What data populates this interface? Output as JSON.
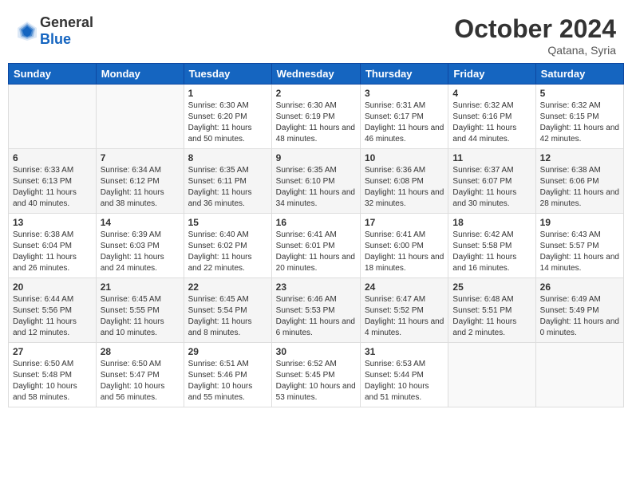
{
  "logo": {
    "general": "General",
    "blue": "Blue"
  },
  "title": "October 2024",
  "location": "Qatana, Syria",
  "days_of_week": [
    "Sunday",
    "Monday",
    "Tuesday",
    "Wednesday",
    "Thursday",
    "Friday",
    "Saturday"
  ],
  "weeks": [
    [
      {
        "day": "",
        "info": ""
      },
      {
        "day": "",
        "info": ""
      },
      {
        "day": "1",
        "info": "Sunrise: 6:30 AM\nSunset: 6:20 PM\nDaylight: 11 hours and 50 minutes."
      },
      {
        "day": "2",
        "info": "Sunrise: 6:30 AM\nSunset: 6:19 PM\nDaylight: 11 hours and 48 minutes."
      },
      {
        "day": "3",
        "info": "Sunrise: 6:31 AM\nSunset: 6:17 PM\nDaylight: 11 hours and 46 minutes."
      },
      {
        "day": "4",
        "info": "Sunrise: 6:32 AM\nSunset: 6:16 PM\nDaylight: 11 hours and 44 minutes."
      },
      {
        "day": "5",
        "info": "Sunrise: 6:32 AM\nSunset: 6:15 PM\nDaylight: 11 hours and 42 minutes."
      }
    ],
    [
      {
        "day": "6",
        "info": "Sunrise: 6:33 AM\nSunset: 6:13 PM\nDaylight: 11 hours and 40 minutes."
      },
      {
        "day": "7",
        "info": "Sunrise: 6:34 AM\nSunset: 6:12 PM\nDaylight: 11 hours and 38 minutes."
      },
      {
        "day": "8",
        "info": "Sunrise: 6:35 AM\nSunset: 6:11 PM\nDaylight: 11 hours and 36 minutes."
      },
      {
        "day": "9",
        "info": "Sunrise: 6:35 AM\nSunset: 6:10 PM\nDaylight: 11 hours and 34 minutes."
      },
      {
        "day": "10",
        "info": "Sunrise: 6:36 AM\nSunset: 6:08 PM\nDaylight: 11 hours and 32 minutes."
      },
      {
        "day": "11",
        "info": "Sunrise: 6:37 AM\nSunset: 6:07 PM\nDaylight: 11 hours and 30 minutes."
      },
      {
        "day": "12",
        "info": "Sunrise: 6:38 AM\nSunset: 6:06 PM\nDaylight: 11 hours and 28 minutes."
      }
    ],
    [
      {
        "day": "13",
        "info": "Sunrise: 6:38 AM\nSunset: 6:04 PM\nDaylight: 11 hours and 26 minutes."
      },
      {
        "day": "14",
        "info": "Sunrise: 6:39 AM\nSunset: 6:03 PM\nDaylight: 11 hours and 24 minutes."
      },
      {
        "day": "15",
        "info": "Sunrise: 6:40 AM\nSunset: 6:02 PM\nDaylight: 11 hours and 22 minutes."
      },
      {
        "day": "16",
        "info": "Sunrise: 6:41 AM\nSunset: 6:01 PM\nDaylight: 11 hours and 20 minutes."
      },
      {
        "day": "17",
        "info": "Sunrise: 6:41 AM\nSunset: 6:00 PM\nDaylight: 11 hours and 18 minutes."
      },
      {
        "day": "18",
        "info": "Sunrise: 6:42 AM\nSunset: 5:58 PM\nDaylight: 11 hours and 16 minutes."
      },
      {
        "day": "19",
        "info": "Sunrise: 6:43 AM\nSunset: 5:57 PM\nDaylight: 11 hours and 14 minutes."
      }
    ],
    [
      {
        "day": "20",
        "info": "Sunrise: 6:44 AM\nSunset: 5:56 PM\nDaylight: 11 hours and 12 minutes."
      },
      {
        "day": "21",
        "info": "Sunrise: 6:45 AM\nSunset: 5:55 PM\nDaylight: 11 hours and 10 minutes."
      },
      {
        "day": "22",
        "info": "Sunrise: 6:45 AM\nSunset: 5:54 PM\nDaylight: 11 hours and 8 minutes."
      },
      {
        "day": "23",
        "info": "Sunrise: 6:46 AM\nSunset: 5:53 PM\nDaylight: 11 hours and 6 minutes."
      },
      {
        "day": "24",
        "info": "Sunrise: 6:47 AM\nSunset: 5:52 PM\nDaylight: 11 hours and 4 minutes."
      },
      {
        "day": "25",
        "info": "Sunrise: 6:48 AM\nSunset: 5:51 PM\nDaylight: 11 hours and 2 minutes."
      },
      {
        "day": "26",
        "info": "Sunrise: 6:49 AM\nSunset: 5:49 PM\nDaylight: 11 hours and 0 minutes."
      }
    ],
    [
      {
        "day": "27",
        "info": "Sunrise: 6:50 AM\nSunset: 5:48 PM\nDaylight: 10 hours and 58 minutes."
      },
      {
        "day": "28",
        "info": "Sunrise: 6:50 AM\nSunset: 5:47 PM\nDaylight: 10 hours and 56 minutes."
      },
      {
        "day": "29",
        "info": "Sunrise: 6:51 AM\nSunset: 5:46 PM\nDaylight: 10 hours and 55 minutes."
      },
      {
        "day": "30",
        "info": "Sunrise: 6:52 AM\nSunset: 5:45 PM\nDaylight: 10 hours and 53 minutes."
      },
      {
        "day": "31",
        "info": "Sunrise: 6:53 AM\nSunset: 5:44 PM\nDaylight: 10 hours and 51 minutes."
      },
      {
        "day": "",
        "info": ""
      },
      {
        "day": "",
        "info": ""
      }
    ]
  ]
}
